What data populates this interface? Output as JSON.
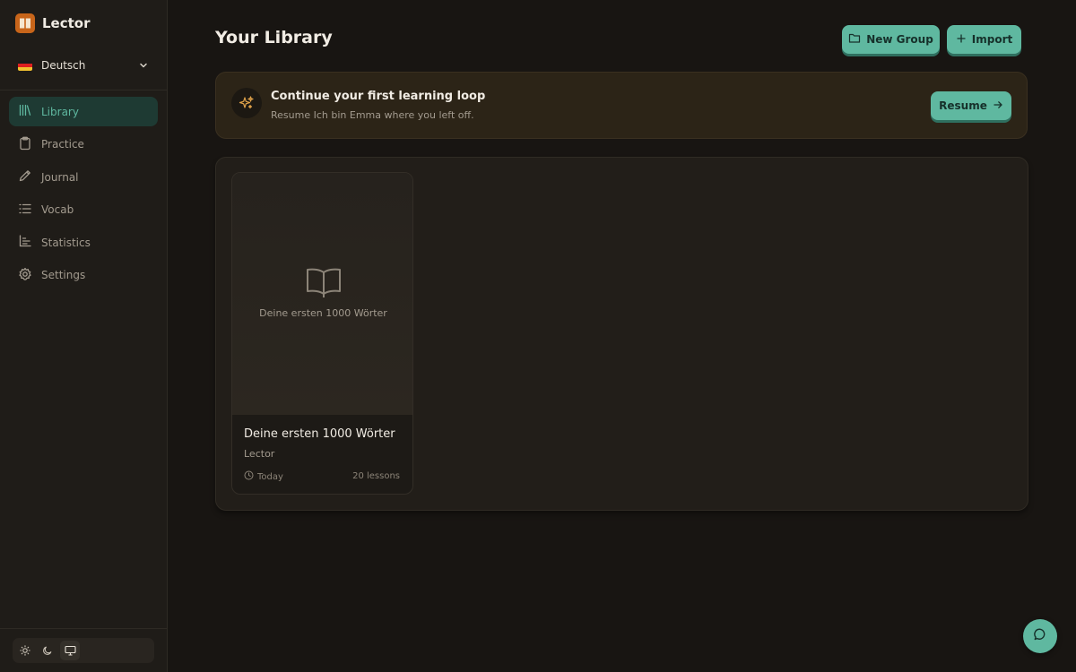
{
  "app": {
    "name": "Lector"
  },
  "sidebar": {
    "language": {
      "label": "Deutsch",
      "flag_colors": [
        "#1a1a1a",
        "#dd2020",
        "#f2c230"
      ]
    },
    "items": [
      {
        "label": "Library",
        "icon": "library-icon",
        "active": true
      },
      {
        "label": "Practice",
        "icon": "clipboard-icon"
      },
      {
        "label": "Journal",
        "icon": "pencil-icon"
      },
      {
        "label": "Vocab",
        "icon": "list-icon"
      },
      {
        "label": "Statistics",
        "icon": "bar-chart-icon"
      },
      {
        "label": "Settings",
        "icon": "gear-icon"
      }
    ],
    "theme_modes": [
      "light",
      "dark",
      "system"
    ],
    "theme_selected": "system"
  },
  "main": {
    "title": "Your Library",
    "actions": {
      "new_group": "New Group",
      "import": "Import"
    },
    "banner": {
      "title": "Continue your first learning loop",
      "subtitle": "Resume Ich bin Emma where you left off.",
      "button": "Resume"
    },
    "books": [
      {
        "cover_title": "Deine ersten 1000 Wörter",
        "title": "Deine ersten 1000 Wörter",
        "author": "Lector",
        "date": "Today",
        "lessons": "20 lessons"
      }
    ]
  },
  "colors": {
    "accent": "#5fb8a0",
    "brand": "#c8651a",
    "background": "#181512"
  }
}
